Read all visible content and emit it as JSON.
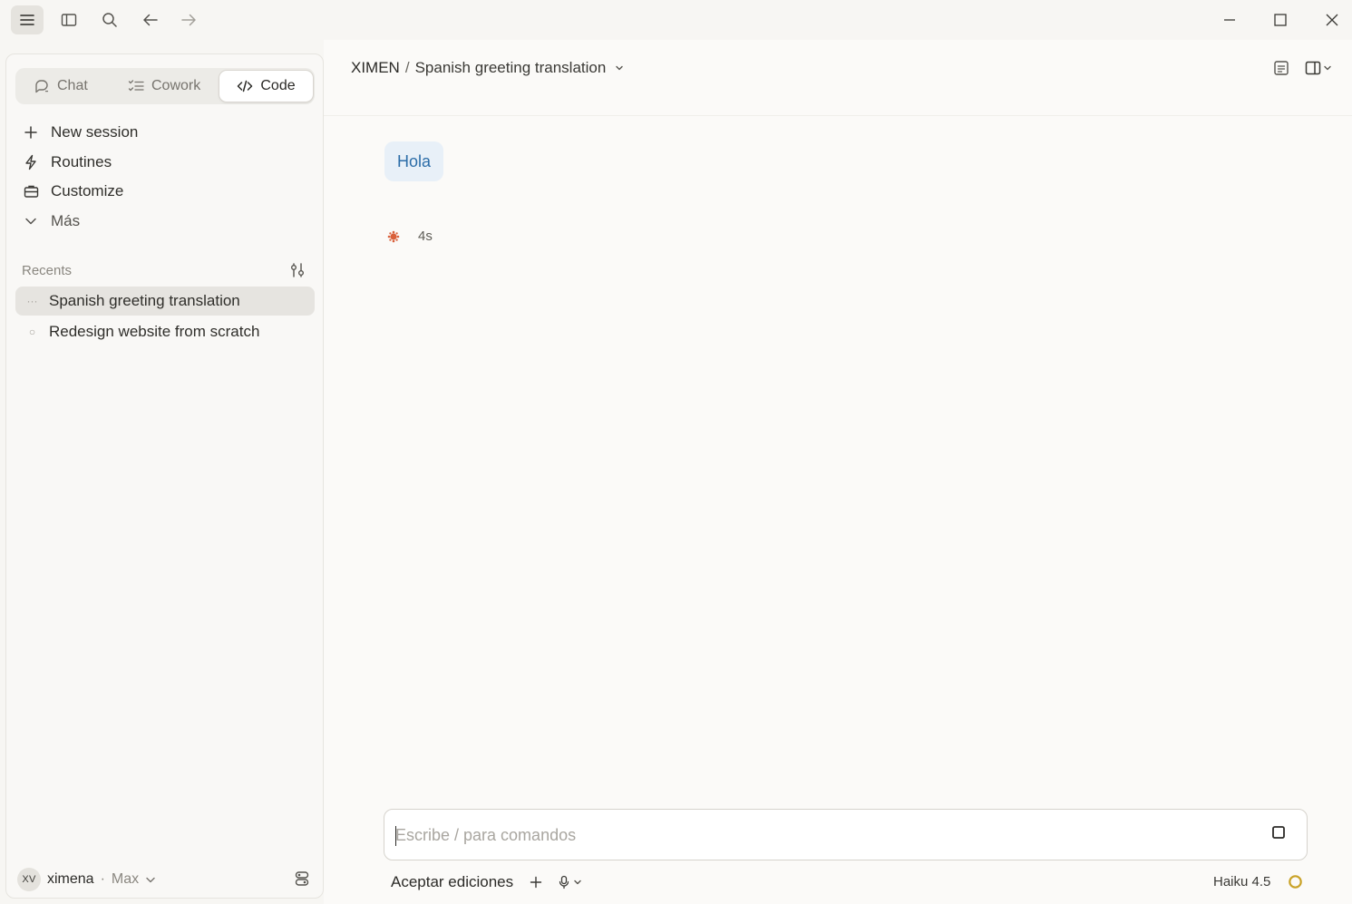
{
  "titlebar": {
    "buttons": [
      "menu-icon",
      "sidebar-toggle-icon",
      "search-icon",
      "arrow-left-icon",
      "arrow-right-icon"
    ],
    "window_controls": [
      "minimize-icon",
      "maximize-icon",
      "close-icon"
    ]
  },
  "sidebar": {
    "modes": [
      {
        "label": "Chat",
        "icon": "chat-icon",
        "active": false
      },
      {
        "label": "Cowork",
        "icon": "checklist-icon",
        "active": false
      },
      {
        "label": "Code",
        "icon": "code-icon",
        "active": true
      }
    ],
    "nav": [
      {
        "label": "New session",
        "icon": "plus-icon"
      },
      {
        "label": "Routines",
        "icon": "bolt-icon"
      },
      {
        "label": "Customize",
        "icon": "briefcase-icon"
      },
      {
        "label": "Más",
        "icon": "chevron-down-icon"
      }
    ],
    "recents_label": "Recents",
    "recents": [
      {
        "label": "Spanish greeting translation",
        "marker": "···",
        "selected": true
      },
      {
        "label": "Redesign website from scratch",
        "marker": "○",
        "selected": false
      }
    ],
    "user": {
      "initials": "XV",
      "name": "ximena",
      "separator": "·",
      "plan": "Max"
    }
  },
  "main": {
    "breadcrumb": {
      "project": "XIMEN",
      "separator": "/",
      "title": "Spanish greeting translation"
    },
    "user_message": "Hola",
    "status": {
      "elapsed": "4s",
      "color": "#d9603b"
    },
    "composer": {
      "placeholder": "Escribe / para comandos",
      "value": ""
    },
    "footer": {
      "mode_label": "Aceptar ediciones",
      "model": "Haiku 4.5"
    }
  },
  "colors": {
    "accent": "#d9603b",
    "bubble_bg": "#e8f0f8",
    "bubble_text": "#2c6da8",
    "ring": "#c9a227"
  }
}
